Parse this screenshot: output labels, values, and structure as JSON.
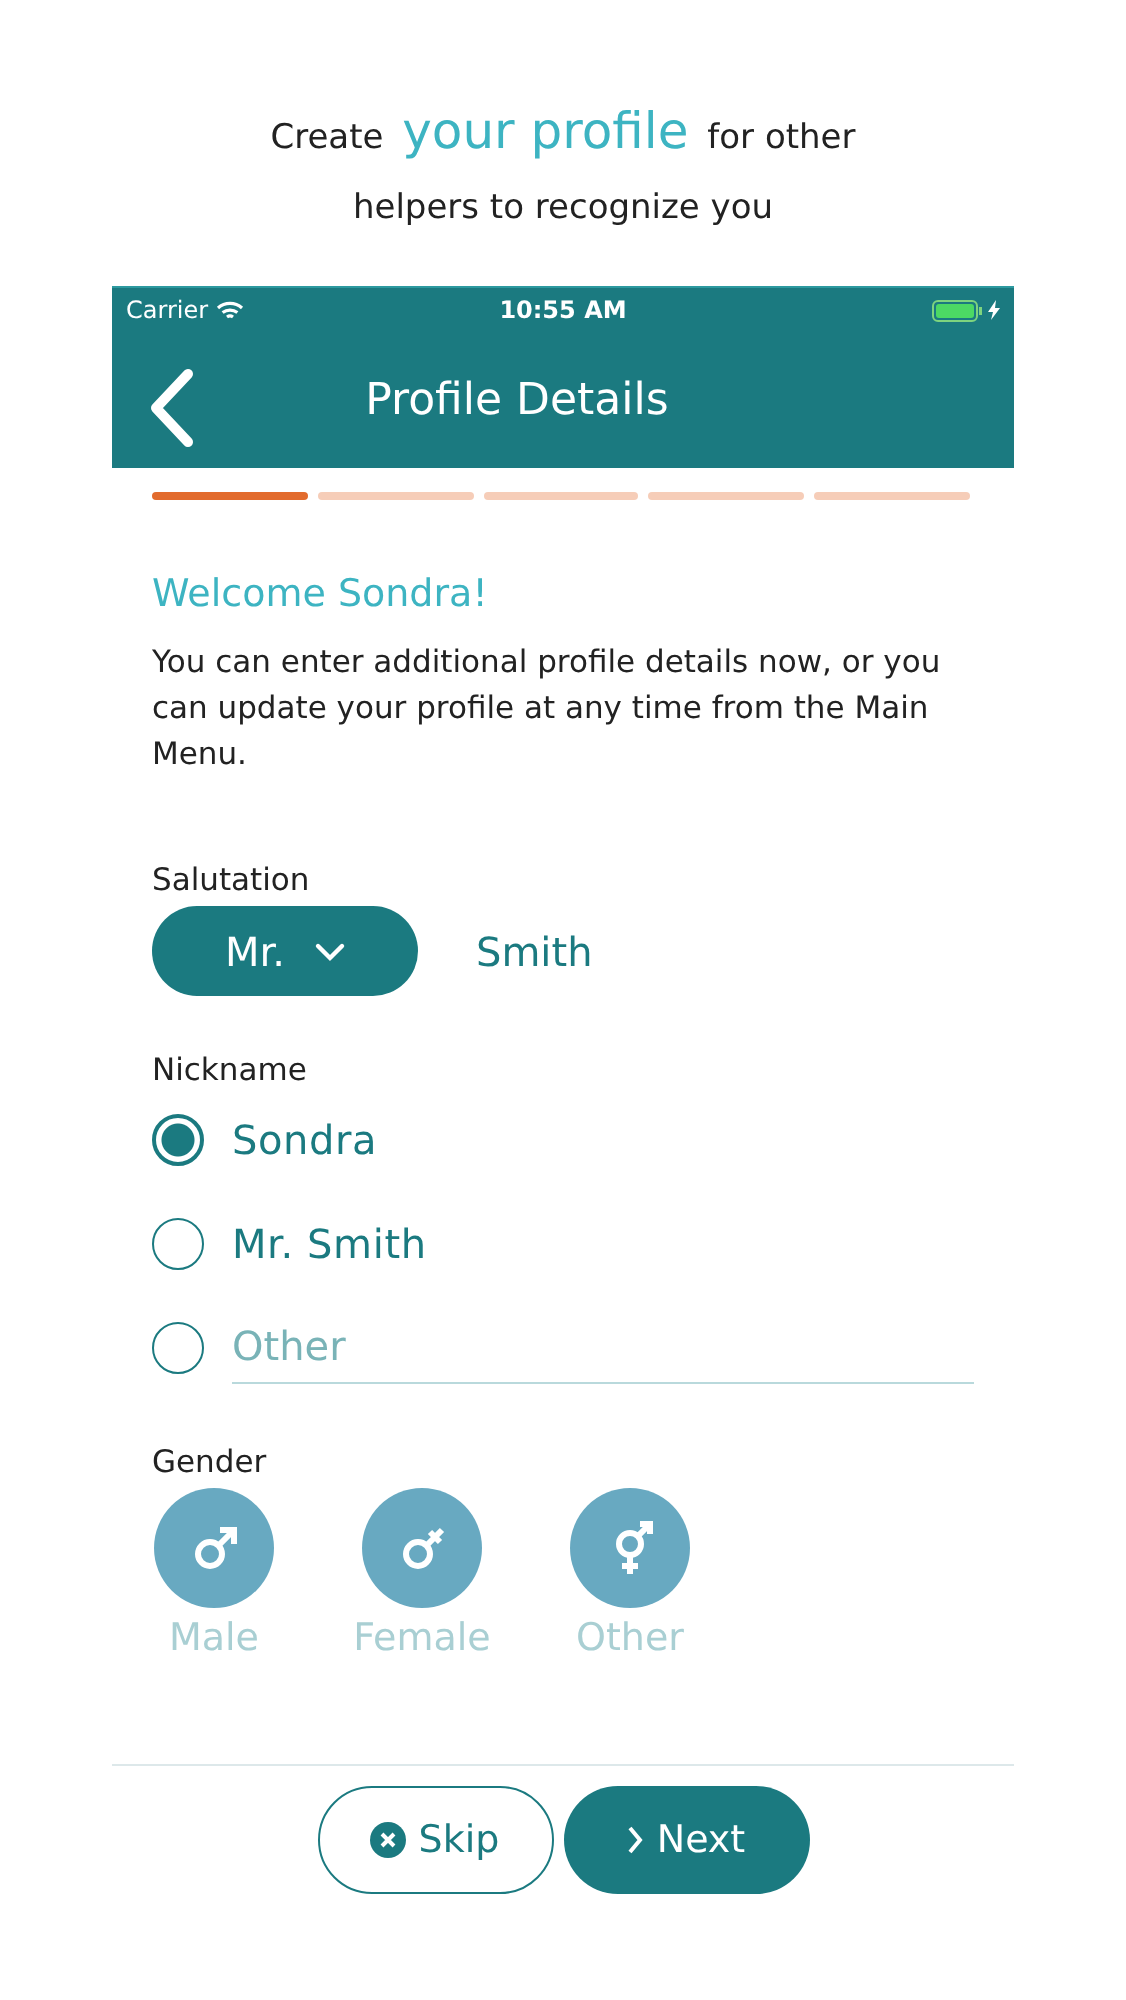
{
  "intro": {
    "lines": [
      "Create **your profile** for other",
      "helpers to recognize you"
    ]
  },
  "status_bar": {
    "carrier": "Carrier",
    "time": "10:55 AM"
  },
  "nav_bar": {
    "title": "Profile Details"
  },
  "progress_steps": [
    {
      "selected": true
    },
    {
      "selected": false
    },
    {
      "selected": false
    },
    {
      "selected": false
    },
    {
      "selected": false
    }
  ],
  "welcome": {
    "title": "Welcome Sondra!",
    "text": "You can enter additional profile details now, or you can update your profile at any time from the Main Menu."
  },
  "salutation": {
    "label": "Salutation",
    "value": "Mr.",
    "last_name": "Smith"
  },
  "nickname": {
    "label": "Nickname",
    "options": [
      {
        "kind": "text",
        "label": "Sondra",
        "selected": true
      },
      {
        "kind": "text",
        "label": "Mr. Smith",
        "selected": false
      },
      {
        "kind": "field",
        "placeholder": "Other",
        "selected": false
      }
    ]
  },
  "gender": {
    "label": "Gender",
    "options": [
      {
        "kind": "male",
        "label": "Male",
        "selected": false
      },
      {
        "kind": "female",
        "label": "Female",
        "selected": false
      },
      {
        "kind": "other",
        "label": "Other",
        "selected": false
      }
    ]
  },
  "buttons": [
    {
      "kind": "skip",
      "label": "Skip"
    },
    {
      "kind": "next",
      "label": "Next"
    }
  ]
}
